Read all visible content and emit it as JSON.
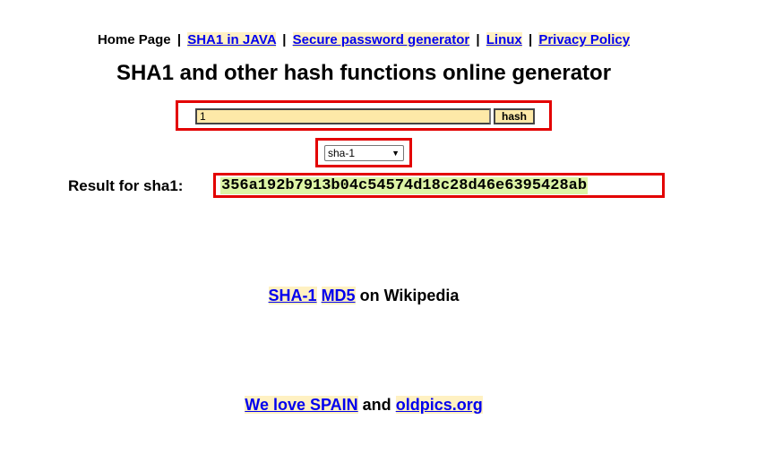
{
  "nav": {
    "home": "Home Page",
    "sep": "|",
    "links": [
      "SHA1 in JAVA",
      "Secure password generator",
      "Linux",
      "Privacy Policy"
    ]
  },
  "title": "SHA1 and other hash functions online generator",
  "form": {
    "input_value": "1",
    "button_label": "hash",
    "algorithm_selected": "sha-1"
  },
  "result": {
    "label": "Result for sha1:",
    "value": "356a192b7913b04c54574d18c28d46e6395428ab"
  },
  "wiki": {
    "links": [
      "SHA-1",
      "MD5"
    ],
    "suffix": "on Wikipedia"
  },
  "footer": {
    "link1": "We love SPAIN",
    "joiner": "and",
    "link2": "oldpics.org"
  },
  "colors": {
    "highlight": "#fde9a8",
    "link_bg": "#fff1c2",
    "result_bg": "#ddf4a6",
    "annotation_border": "#e30000",
    "link": "#0000ee"
  }
}
